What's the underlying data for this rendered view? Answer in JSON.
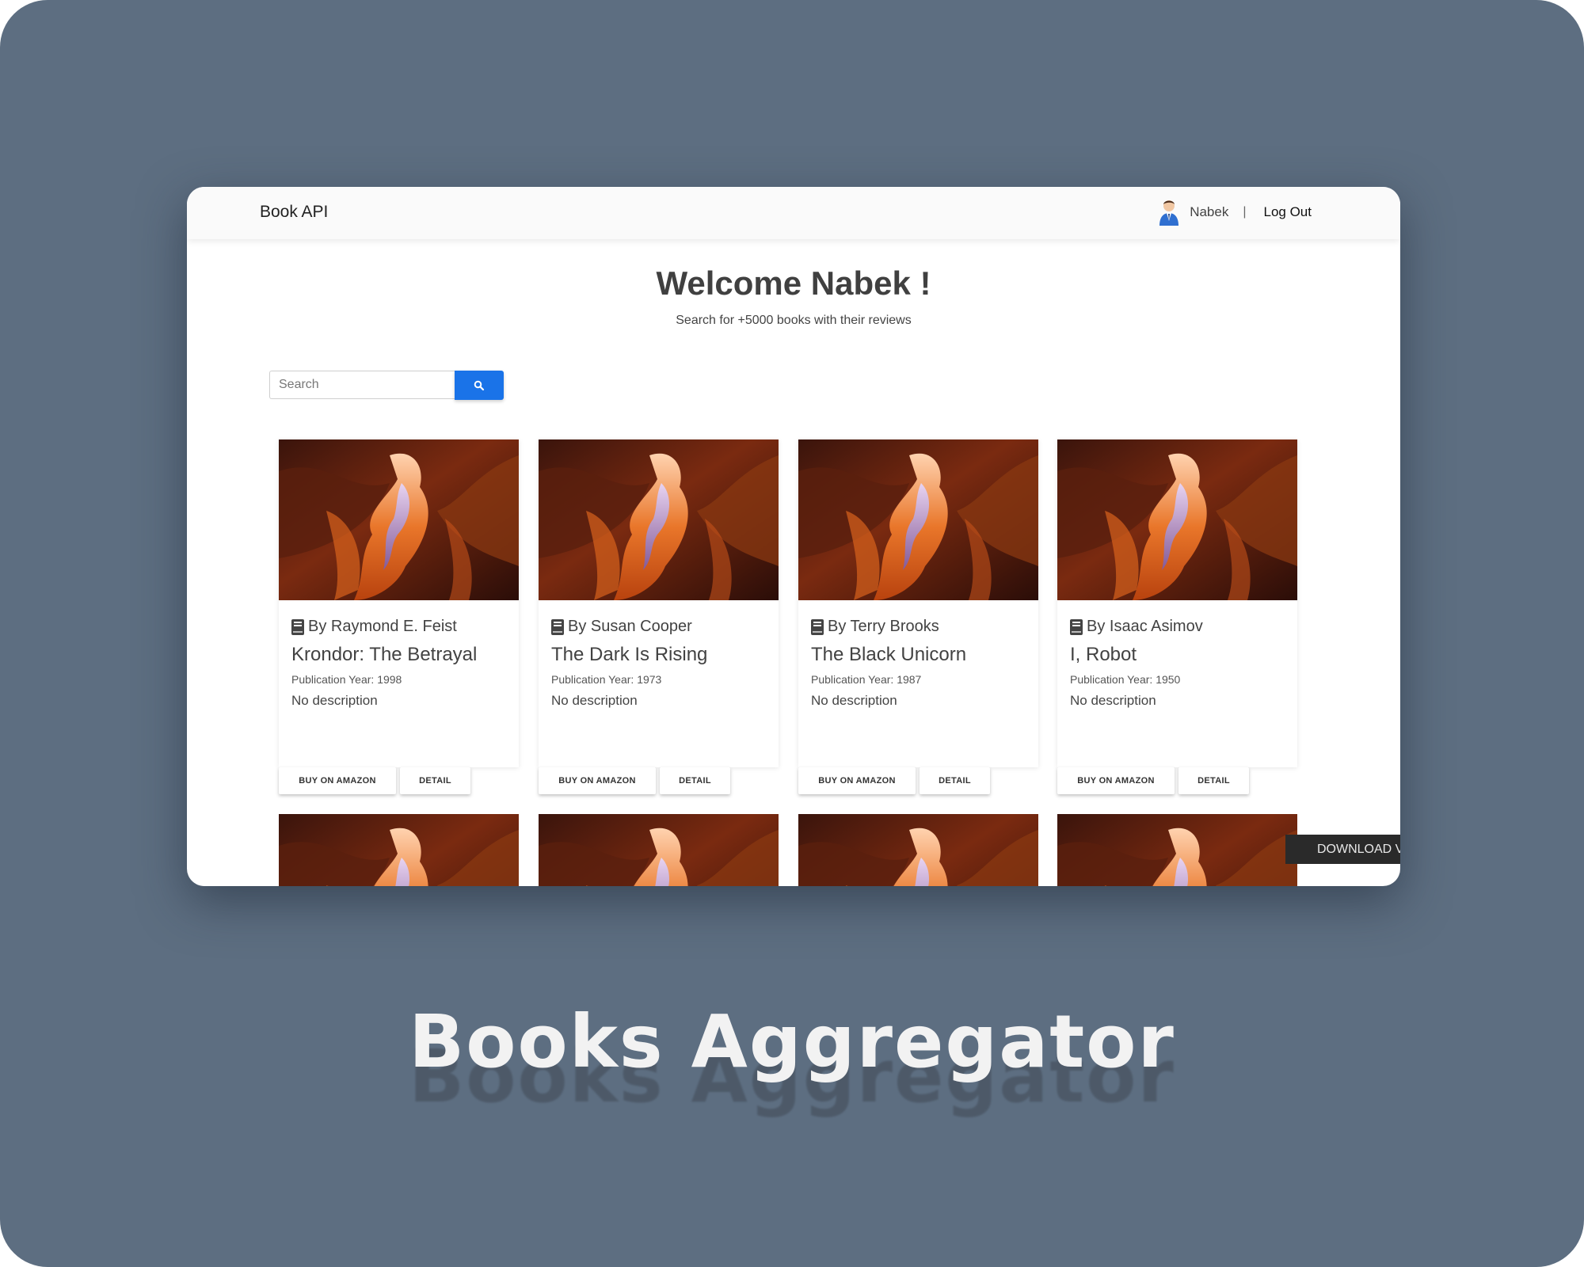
{
  "app": {
    "brand": "Book API"
  },
  "header": {
    "username": "Nabek",
    "separator": "|",
    "logout_label": "Log Out"
  },
  "hero": {
    "title": "Welcome Nabek !",
    "subtitle": "Search for +5000 books with their reviews"
  },
  "search": {
    "placeholder": "Search"
  },
  "books": [
    {
      "author": "By Raymond E. Feist",
      "title": "Krondor: The Betrayal",
      "year": "Publication Year: 1998",
      "description": "No description",
      "buy_label": "BUY ON AMAZON",
      "detail_label": "DETAIL"
    },
    {
      "author": "By Susan Cooper",
      "title": "The Dark Is Rising",
      "year": "Publication Year: 1973",
      "description": "No description",
      "buy_label": "BUY ON AMAZON",
      "detail_label": "DETAIL"
    },
    {
      "author": "By Terry Brooks",
      "title": "The Black Unicorn",
      "year": "Publication Year: 1987",
      "description": "No description",
      "buy_label": "BUY ON AMAZON",
      "detail_label": "DETAIL"
    },
    {
      "author": "By Isaac Asimov",
      "title": "I, Robot",
      "year": "Publication Year: 1950",
      "description": "No description",
      "buy_label": "BUY ON AMAZON",
      "detail_label": "DETAIL"
    }
  ],
  "download_label": "DOWNLOAD V",
  "caption": "Books Aggregator",
  "colors": {
    "backdrop": "#5d6e81",
    "accent": "#1a73e8",
    "download_bg": "#2a2a2a"
  },
  "icons": {
    "search": "search-icon",
    "book": "book-icon",
    "avatar": "avatar-icon"
  }
}
